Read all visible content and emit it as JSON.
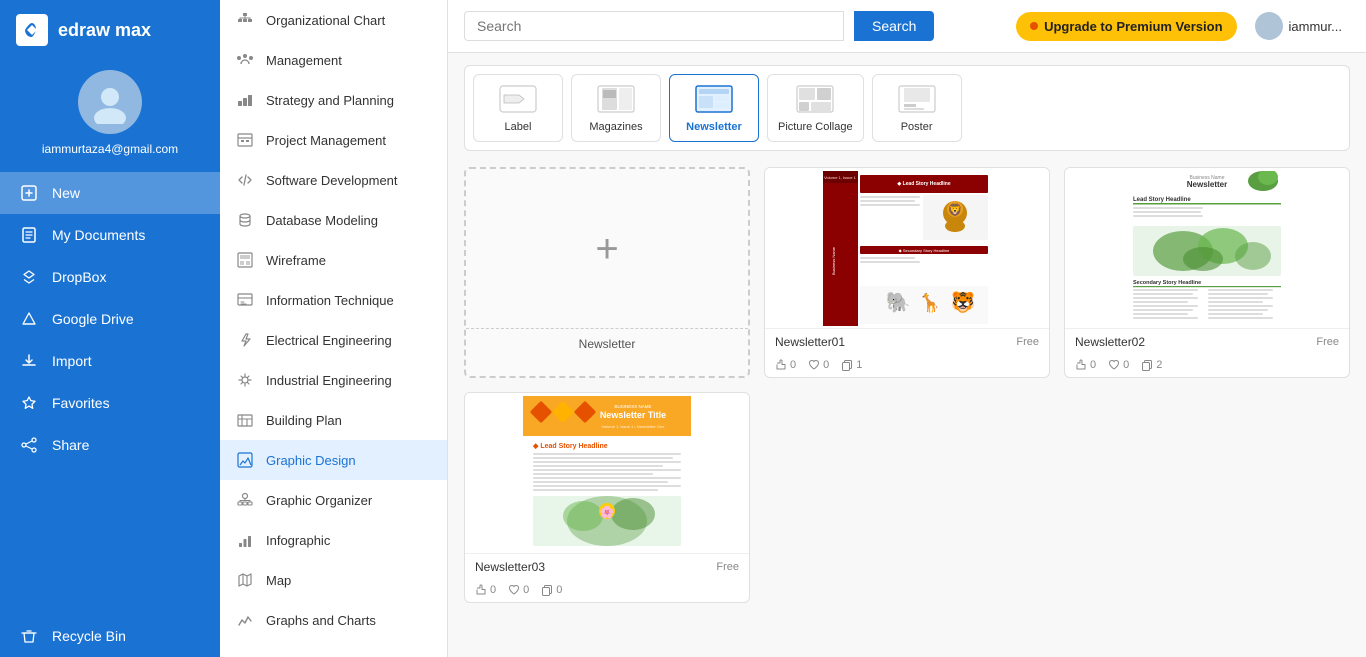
{
  "app": {
    "name": "edraw max"
  },
  "user": {
    "email": "iammurtaza4@gmail.com",
    "display": "iammur..."
  },
  "header": {
    "search_placeholder": "Search",
    "search_btn": "Search",
    "upgrade_btn": "Upgrade to Premium Version"
  },
  "left_nav": {
    "items": [
      {
        "id": "new",
        "label": "New",
        "icon": "new-icon"
      },
      {
        "id": "my-documents",
        "label": "My Documents",
        "icon": "docs-icon"
      },
      {
        "id": "dropbox",
        "label": "DropBox",
        "icon": "dropbox-icon"
      },
      {
        "id": "google-drive",
        "label": "Google Drive",
        "icon": "drive-icon"
      },
      {
        "id": "import",
        "label": "Import",
        "icon": "import-icon"
      },
      {
        "id": "favorites",
        "label": "Favorites",
        "icon": "favorites-icon"
      },
      {
        "id": "share",
        "label": "Share",
        "icon": "share-icon"
      },
      {
        "id": "recycle-bin",
        "label": "Recycle Bin",
        "icon": "recycle-icon"
      }
    ]
  },
  "second_sidebar": {
    "items": [
      {
        "id": "org-chart",
        "label": "Organizational Chart",
        "icon": "org-icon"
      },
      {
        "id": "management",
        "label": "Management",
        "icon": "mgmt-icon"
      },
      {
        "id": "strategy",
        "label": "Strategy and Planning",
        "icon": "strategy-icon"
      },
      {
        "id": "project-mgmt",
        "label": "Project Management",
        "icon": "projmgmt-icon"
      },
      {
        "id": "software-dev",
        "label": "Software Development",
        "icon": "softdev-icon"
      },
      {
        "id": "db-modeling",
        "label": "Database Modeling",
        "icon": "db-icon"
      },
      {
        "id": "wireframe",
        "label": "Wireframe",
        "icon": "wire-icon"
      },
      {
        "id": "info-technique",
        "label": "Information Technique",
        "icon": "info-icon"
      },
      {
        "id": "electrical-eng",
        "label": "Electrical Engineering",
        "icon": "elec-icon"
      },
      {
        "id": "industrial-eng",
        "label": "Industrial Engineering",
        "icon": "indus-icon"
      },
      {
        "id": "building-plan",
        "label": "Building Plan",
        "icon": "build-icon"
      },
      {
        "id": "graphic-design",
        "label": "Graphic Design",
        "icon": "graphic-icon",
        "active": true
      },
      {
        "id": "graphic-organizer",
        "label": "Graphic Organizer",
        "icon": "gorg-icon"
      },
      {
        "id": "infographic",
        "label": "Infographic",
        "icon": "infog-icon"
      },
      {
        "id": "map",
        "label": "Map",
        "icon": "map-icon"
      },
      {
        "id": "graphs-charts",
        "label": "Graphs and Charts",
        "icon": "chart-icon"
      }
    ]
  },
  "top_templates": [
    {
      "id": "label",
      "label": "Label",
      "selected": false
    },
    {
      "id": "magazines",
      "label": "Magazines",
      "selected": false
    },
    {
      "id": "newsletter",
      "label": "Newsletter",
      "selected": true
    },
    {
      "id": "picture-collage",
      "label": "Picture Collage",
      "selected": false
    },
    {
      "id": "poster",
      "label": "Poster",
      "selected": false
    }
  ],
  "cards": [
    {
      "id": "new-newsletter",
      "type": "new",
      "label": "Newsletter"
    },
    {
      "id": "newsletter01",
      "type": "template",
      "title": "Newsletter01",
      "badge": "Free",
      "likes": 0,
      "hearts": 0,
      "copies": 1,
      "preview": "nl01"
    },
    {
      "id": "newsletter02",
      "type": "template",
      "title": "Newsletter02",
      "badge": "Free",
      "likes": 0,
      "hearts": 0,
      "copies": 2,
      "preview": "nl02"
    },
    {
      "id": "newsletter03",
      "type": "template",
      "title": "Newsletter03",
      "badge": "Free",
      "likes": 0,
      "hearts": 0,
      "copies": 0,
      "preview": "nl03"
    }
  ]
}
